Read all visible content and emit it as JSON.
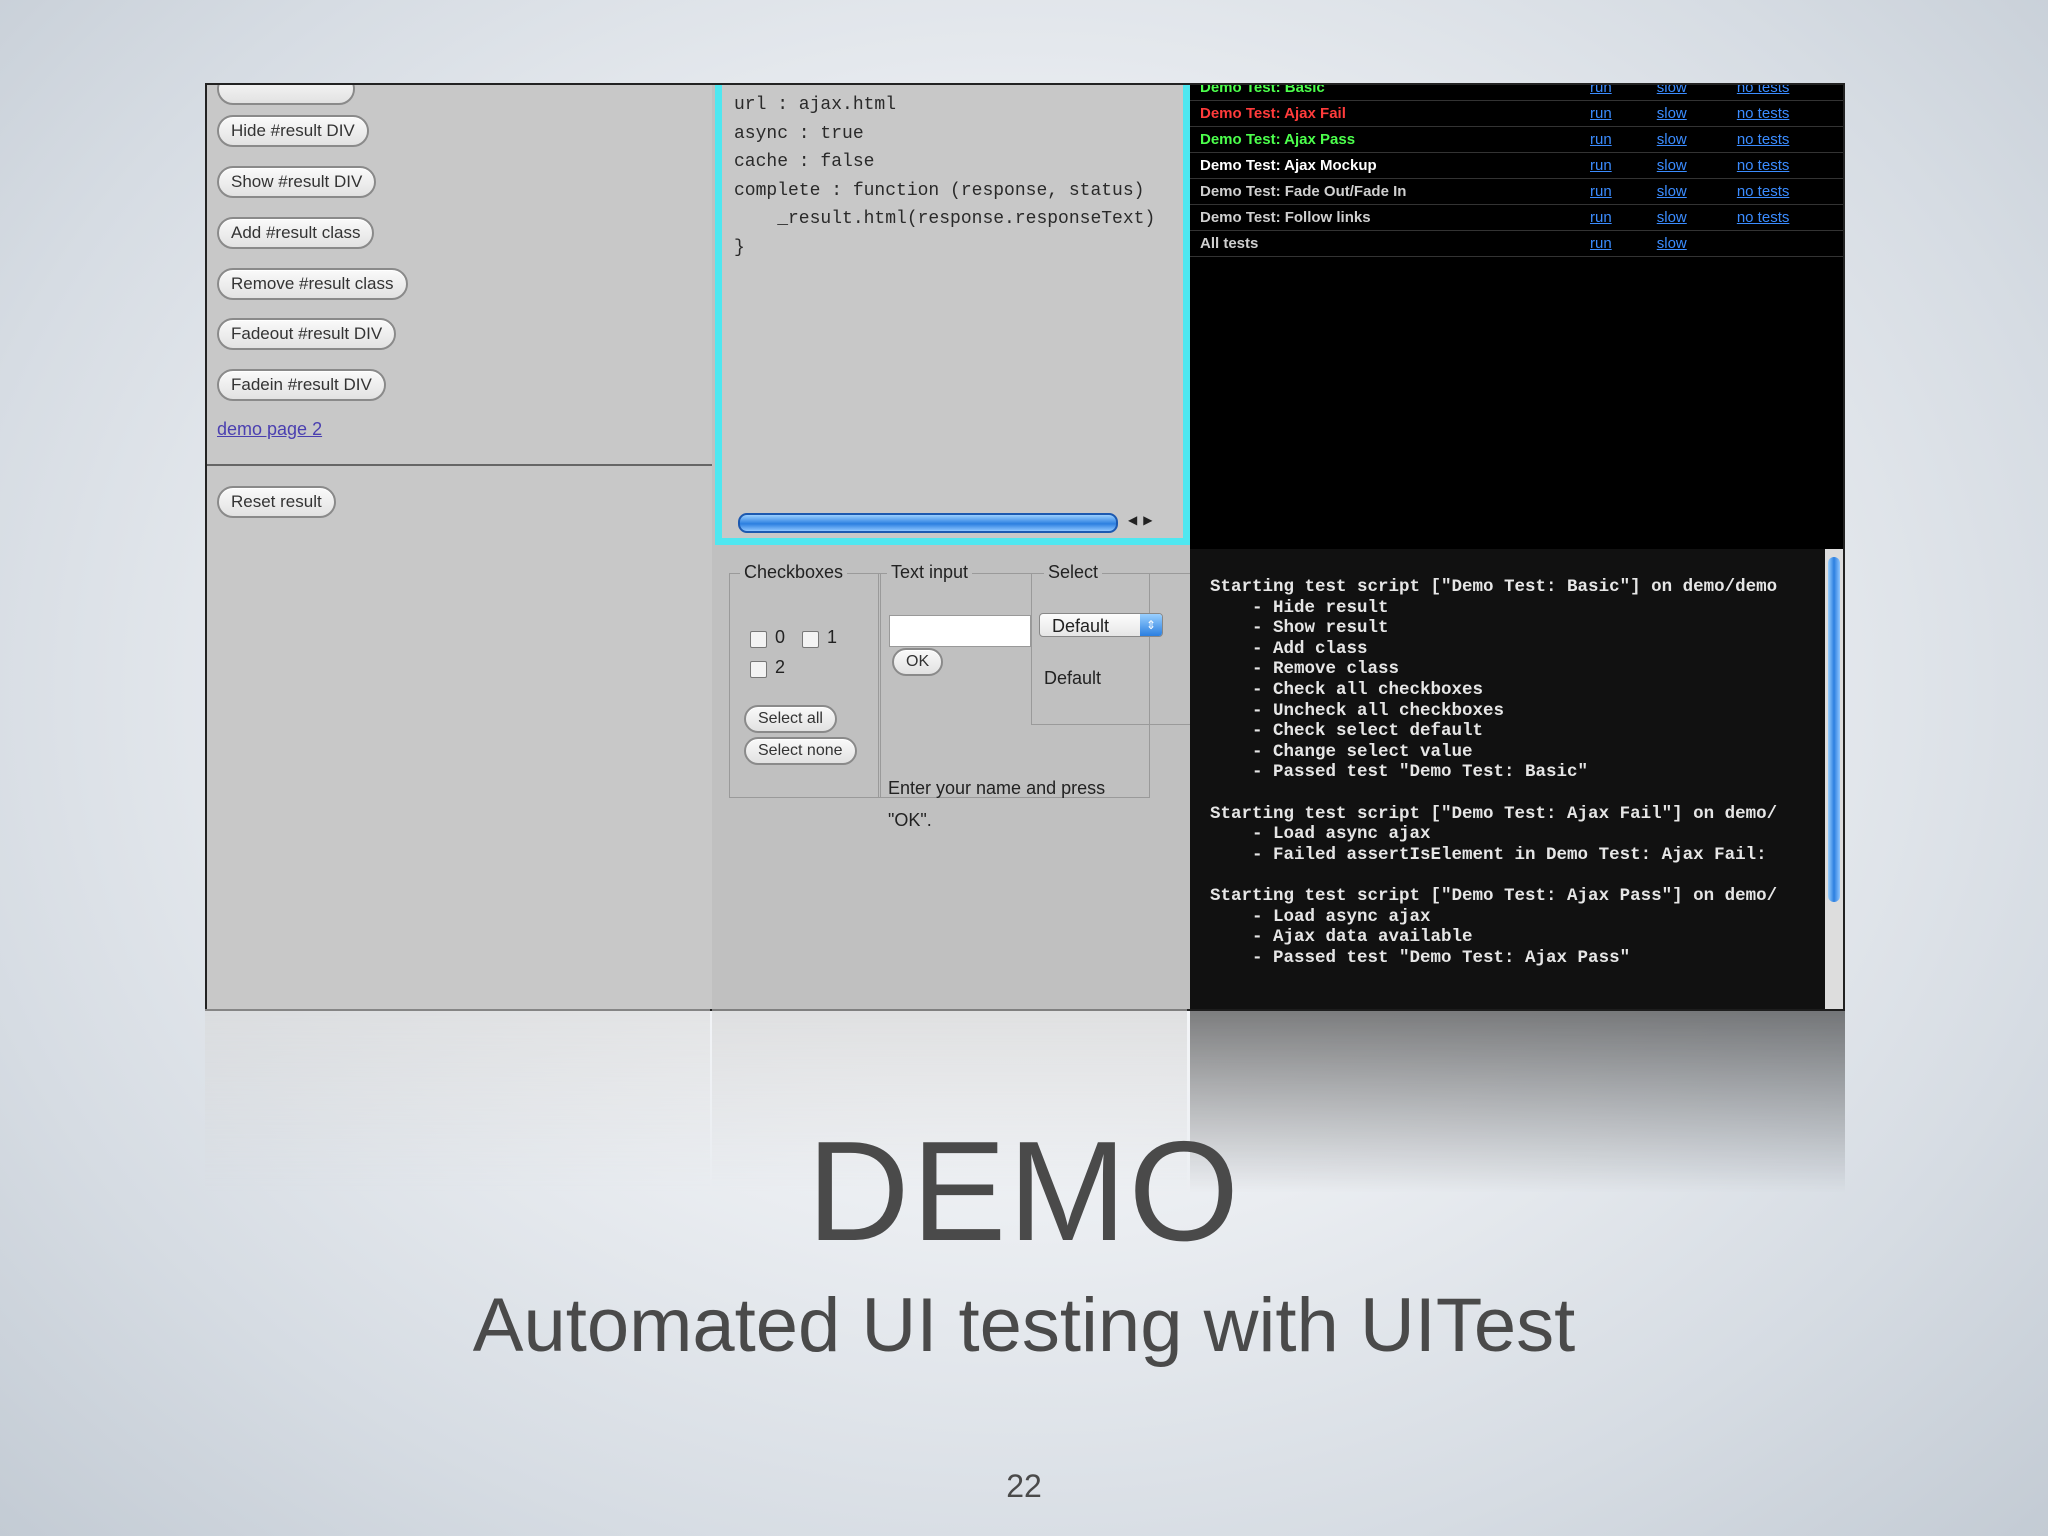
{
  "left_panel": {
    "buttons": [
      "Hide #result DIV",
      "Show #result DIV",
      "Add #result class",
      "Remove #result class",
      "Fadeout #result DIV",
      "Fadein #result DIV"
    ],
    "link": "demo page 2",
    "reset_button": "Reset result"
  },
  "code": {
    "lines": [
      "url : ajax.html",
      "async : true",
      "cache : false",
      "complete : function (response, status)",
      "    _result.html(response.responseText)",
      "}"
    ]
  },
  "forms": {
    "checkboxes_legend": "Checkboxes",
    "cb0": "0",
    "cb1": "1",
    "cb2": "2",
    "select_all": "Select all",
    "select_none": "Select none",
    "text_input_legend": "Text input",
    "ok": "OK",
    "help_line1": "Enter your name and press",
    "help_line2": "\"OK\".",
    "select_legend": "Select",
    "select_value": "Default",
    "select_output": "Default"
  },
  "tests": {
    "rows": [
      {
        "name": "Demo Test: Basic",
        "color": "#4cff4c",
        "links": [
          "run",
          "slow",
          "no tests"
        ]
      },
      {
        "name": "Demo Test: Ajax Fail",
        "color": "#ff3b3b",
        "links": [
          "run",
          "slow",
          "no tests"
        ]
      },
      {
        "name": "Demo Test: Ajax Pass",
        "color": "#4cff4c",
        "links": [
          "run",
          "slow",
          "no tests"
        ]
      },
      {
        "name": "Demo Test: Ajax Mockup",
        "color": "#ffffff",
        "links": [
          "run",
          "slow",
          "no tests"
        ]
      },
      {
        "name": "Demo Test: Fade Out/Fade In",
        "color": "#cfcfcf",
        "links": [
          "run",
          "slow",
          "no tests"
        ]
      },
      {
        "name": "Demo Test: Follow links",
        "color": "#cfcfcf",
        "links": [
          "run",
          "slow",
          "no tests"
        ]
      },
      {
        "name": "All tests",
        "color": "#cfcfcf",
        "links": [
          "run",
          "slow",
          ""
        ]
      }
    ]
  },
  "console": {
    "text": "Starting test script [\"Demo Test: Basic\"] on demo/demo\n    - Hide result\n    - Show result\n    - Add class\n    - Remove class\n    - Check all checkboxes\n    - Uncheck all checkboxes\n    - Check select default\n    - Change select value\n    - Passed test \"Demo Test: Basic\"\n\nStarting test script [\"Demo Test: Ajax Fail\"] on demo/\n    - Load async ajax\n    - Failed assertIsElement in Demo Test: Ajax Fail:\n\nStarting test script [\"Demo Test: Ajax Pass\"] on demo/\n    - Load async ajax\n    - Ajax data available\n    - Passed test \"Demo Test: Ajax Pass\""
  },
  "slide": {
    "title": "DEMO",
    "subtitle": "Automated UI testing with UITest",
    "page_number": "22"
  }
}
